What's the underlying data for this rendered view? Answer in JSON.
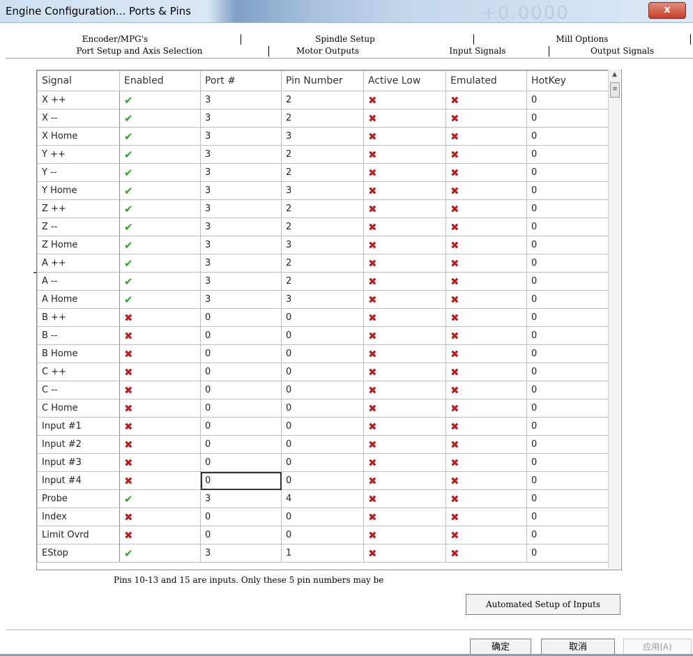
{
  "window": {
    "title": "Engine Configuration... Ports & Pins",
    "close_label": "x"
  },
  "tabs_row1": [
    "Encoder/MPG's",
    "Spindle Setup",
    "Mill Options"
  ],
  "tabs_row2": [
    "Port Setup and Axis Selection",
    "Motor Outputs",
    "Input Signals",
    "Output Signals"
  ],
  "active_tab": "Input Signals",
  "grid": {
    "columns": [
      "Signal",
      "Enabled",
      "Port #",
      "Pin Number",
      "Active Low",
      "Emulated",
      "HotKey"
    ],
    "rows": [
      {
        "signal": "X ++",
        "enabled": true,
        "port": "3",
        "pin": "2",
        "active_low": false,
        "emulated": false,
        "hotkey": "0"
      },
      {
        "signal": "X --",
        "enabled": true,
        "port": "3",
        "pin": "2",
        "active_low": false,
        "emulated": false,
        "hotkey": "0"
      },
      {
        "signal": "X Home",
        "enabled": true,
        "port": "3",
        "pin": "3",
        "active_low": false,
        "emulated": false,
        "hotkey": "0"
      },
      {
        "signal": "Y ++",
        "enabled": true,
        "port": "3",
        "pin": "2",
        "active_low": false,
        "emulated": false,
        "hotkey": "0"
      },
      {
        "signal": "Y --",
        "enabled": true,
        "port": "3",
        "pin": "2",
        "active_low": false,
        "emulated": false,
        "hotkey": "0"
      },
      {
        "signal": "Y Home",
        "enabled": true,
        "port": "3",
        "pin": "3",
        "active_low": false,
        "emulated": false,
        "hotkey": "0"
      },
      {
        "signal": "Z ++",
        "enabled": true,
        "port": "3",
        "pin": "2",
        "active_low": false,
        "emulated": false,
        "hotkey": "0"
      },
      {
        "signal": "Z --",
        "enabled": true,
        "port": "3",
        "pin": "2",
        "active_low": false,
        "emulated": false,
        "hotkey": "0"
      },
      {
        "signal": "Z Home",
        "enabled": true,
        "port": "3",
        "pin": "3",
        "active_low": false,
        "emulated": false,
        "hotkey": "0"
      },
      {
        "signal": "A ++",
        "enabled": true,
        "port": "3",
        "pin": "2",
        "active_low": false,
        "emulated": false,
        "hotkey": "0"
      },
      {
        "signal": "A --",
        "enabled": true,
        "port": "3",
        "pin": "2",
        "active_low": false,
        "emulated": false,
        "hotkey": "0"
      },
      {
        "signal": "A Home",
        "enabled": true,
        "port": "3",
        "pin": "3",
        "active_low": false,
        "emulated": false,
        "hotkey": "0"
      },
      {
        "signal": "B ++",
        "enabled": false,
        "port": "0",
        "pin": "0",
        "active_low": false,
        "emulated": false,
        "hotkey": "0"
      },
      {
        "signal": "B --",
        "enabled": false,
        "port": "0",
        "pin": "0",
        "active_low": false,
        "emulated": false,
        "hotkey": "0"
      },
      {
        "signal": "B Home",
        "enabled": false,
        "port": "0",
        "pin": "0",
        "active_low": false,
        "emulated": false,
        "hotkey": "0"
      },
      {
        "signal": "C ++",
        "enabled": false,
        "port": "0",
        "pin": "0",
        "active_low": false,
        "emulated": false,
        "hotkey": "0"
      },
      {
        "signal": "C --",
        "enabled": false,
        "port": "0",
        "pin": "0",
        "active_low": false,
        "emulated": false,
        "hotkey": "0"
      },
      {
        "signal": "C Home",
        "enabled": false,
        "port": "0",
        "pin": "0",
        "active_low": false,
        "emulated": false,
        "hotkey": "0"
      },
      {
        "signal": "Input #1",
        "enabled": false,
        "port": "0",
        "pin": "0",
        "active_low": false,
        "emulated": false,
        "hotkey": "0"
      },
      {
        "signal": "Input #2",
        "enabled": false,
        "port": "0",
        "pin": "0",
        "active_low": false,
        "emulated": false,
        "hotkey": "0"
      },
      {
        "signal": "Input #3",
        "enabled": false,
        "port": "0",
        "pin": "0",
        "active_low": false,
        "emulated": false,
        "hotkey": "0"
      },
      {
        "signal": "Input #4",
        "enabled": false,
        "port": "0",
        "pin": "0",
        "active_low": false,
        "emulated": false,
        "hotkey": "0",
        "selected": true
      },
      {
        "signal": "Probe",
        "enabled": true,
        "port": "3",
        "pin": "4",
        "active_low": false,
        "emulated": false,
        "hotkey": "0"
      },
      {
        "signal": "Index",
        "enabled": false,
        "port": "0",
        "pin": "0",
        "active_low": false,
        "emulated": false,
        "hotkey": "0"
      },
      {
        "signal": "Limit Ovrd",
        "enabled": false,
        "port": "0",
        "pin": "0",
        "active_low": false,
        "emulated": false,
        "hotkey": "0"
      },
      {
        "signal": "EStop",
        "enabled": true,
        "port": "3",
        "pin": "1",
        "active_low": false,
        "emulated": false,
        "hotkey": "0"
      }
    ]
  },
  "note": "Pins 10-13 and 15 are inputs. Only these 5 pin numbers may be",
  "buttons": {
    "automated_setup": "Automated Setup of Inputs",
    "ok": "确定",
    "cancel": "取消",
    "apply": "应用(A)"
  },
  "icons": {
    "enabled_true": "green-check-icon",
    "enabled_false": "red-x-icon"
  },
  "colors": {
    "check": "#2aa12a",
    "xmark": "#b81f1f",
    "close_button": "#c4402c"
  }
}
